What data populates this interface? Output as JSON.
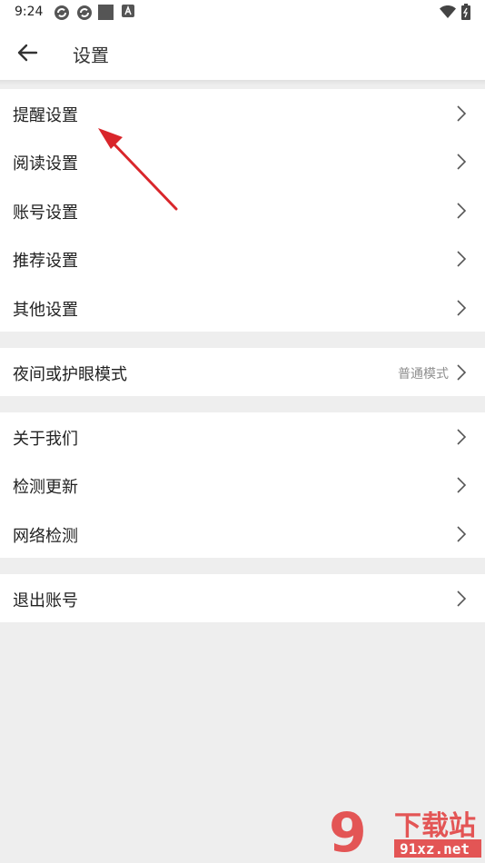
{
  "status_bar": {
    "time": "9:24",
    "icons": [
      "sync-icon",
      "sync-icon",
      "square-icon",
      "letter-a-icon",
      "wifi-icon",
      "battery-icon"
    ]
  },
  "app_bar": {
    "title": "设置",
    "back_icon": "back-arrow-icon"
  },
  "groups": [
    {
      "items": [
        {
          "label": "提醒设置"
        },
        {
          "label": "阅读设置"
        },
        {
          "label": "账号设置"
        },
        {
          "label": "推荐设置"
        },
        {
          "label": "其他设置"
        }
      ]
    },
    {
      "items": [
        {
          "label": "夜间或护眼模式",
          "value": "普通模式"
        }
      ]
    },
    {
      "items": [
        {
          "label": "关于我们"
        },
        {
          "label": "检测更新"
        },
        {
          "label": "网络检测"
        }
      ]
    },
    {
      "items": [
        {
          "label": "退出账号"
        }
      ]
    }
  ],
  "colors": {
    "background": "#eeeeee",
    "surface": "#ffffff",
    "annotation_arrow": "#d9262b",
    "watermark": "#e23b3b"
  },
  "watermark": {
    "brand": "下载站",
    "prefix": "9",
    "domain": "91xz.net"
  }
}
